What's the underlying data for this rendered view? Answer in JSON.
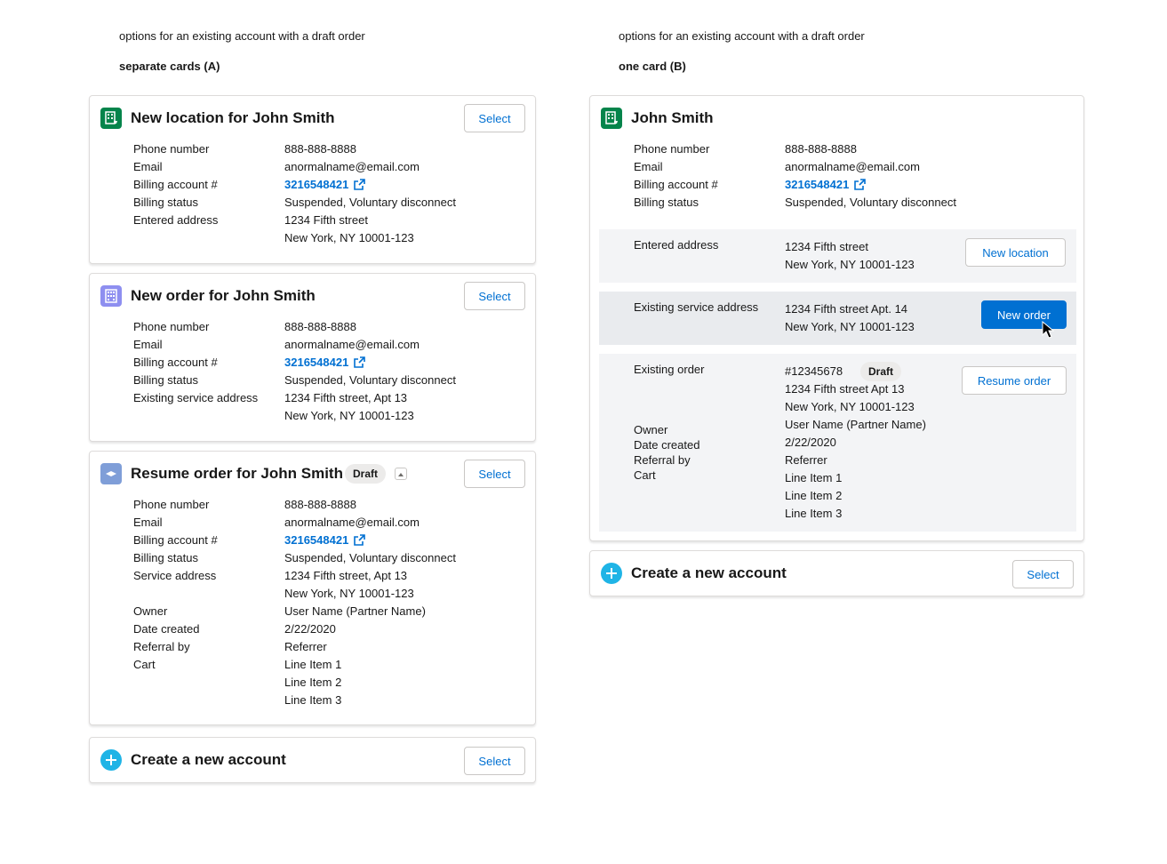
{
  "left": {
    "caption": "options for an existing account with a draft order",
    "subcaption": "separate cards (A)",
    "card1": {
      "icon": "building-cart-icon",
      "title": "New location for John Smith",
      "select": "Select",
      "rows": [
        {
          "label": "Phone number",
          "value": "888-888-8888"
        },
        {
          "label": "Email",
          "value": "anormalname@email.com"
        },
        {
          "label": "Billing account #",
          "value": "3216548421"
        },
        {
          "label": "Billing status",
          "value": "Suspended, Voluntary disconnect"
        },
        {
          "label": "Entered address",
          "value": "1234 Fifth street"
        },
        {
          "label": "",
          "value": "New York, NY 10001-123"
        }
      ]
    },
    "card2": {
      "icon": "building-grid-icon",
      "title": "New order for John Smith",
      "select": "Select",
      "rows": [
        {
          "label": "Phone number",
          "value": "888-888-8888"
        },
        {
          "label": "Email",
          "value": "anormalname@email.com"
        },
        {
          "label": "Billing account #",
          "value": "3216548421"
        },
        {
          "label": "Billing status",
          "value": "Suspended, Voluntary disconnect"
        },
        {
          "label": "Existing service address",
          "value": "1234 Fifth street, Apt 13"
        },
        {
          "label": "",
          "value": "New York, NY 10001-123"
        }
      ]
    },
    "card3": {
      "icon": "order-icon",
      "title": "Resume order for John Smith",
      "badge": "Draft",
      "select": "Select",
      "rows": [
        {
          "label": "Phone number",
          "value": "888-888-8888"
        },
        {
          "label": "Email",
          "value": "anormalname@email.com"
        },
        {
          "label": "Billing account #",
          "value": "3216548421"
        },
        {
          "label": "Billing status",
          "value": "Suspended, Voluntary disconnect"
        },
        {
          "label": "Service address",
          "value": "1234 Fifth street, Apt 13"
        },
        {
          "label": "",
          "value": "New York, NY 10001-123"
        },
        {
          "label": "Owner",
          "value": "User Name (Partner Name)"
        },
        {
          "label": "Date created",
          "value": "2/22/2020"
        },
        {
          "label": "Referral by",
          "value": "Referrer"
        },
        {
          "label": "Cart",
          "value": "Line Item 1"
        },
        {
          "label": "",
          "value": "Line Item 2"
        },
        {
          "label": "",
          "value": "Line Item 3"
        }
      ]
    },
    "card4": {
      "icon": "add-icon",
      "title": "Create a new account",
      "select": "Select"
    }
  },
  "right": {
    "caption": "options for an existing account with a draft order",
    "subcaption": "one card (B)",
    "card": {
      "icon": "building-cart-icon",
      "title": "John Smith",
      "rows": [
        {
          "label": "Phone number",
          "value": "888-888-8888"
        },
        {
          "label": "Email",
          "value": "anormalname@email.com"
        },
        {
          "label": "Billing account #",
          "value": "3216548421"
        },
        {
          "label": "Billing status",
          "value": "Suspended, Voluntary disconnect"
        }
      ],
      "entered": {
        "label": "Entered address",
        "line1": "1234 Fifth street",
        "line2": "New York, NY 10001-123",
        "button": "New location"
      },
      "existing_service": {
        "label": "Existing service address",
        "line1": "1234 Fifth street Apt. 14",
        "line2": "New York, NY 10001-123",
        "button": "New order"
      },
      "existing_order": {
        "label": "Existing order",
        "number": "#12345678",
        "badge": "Draft",
        "line1": "1234 Fifth street Apt 13",
        "line2": "New York, NY 10001-123",
        "button": "Resume order",
        "labels": [
          "Owner",
          "Date created",
          "Referral by",
          "Cart"
        ],
        "values": [
          "User Name (Partner Name)",
          "2/22/2020",
          "Referrer",
          "Line Item 1",
          "Line Item 2",
          "Line Item 3"
        ]
      }
    },
    "create": {
      "icon": "add-icon",
      "title": "Create a new account",
      "select": "Select"
    }
  },
  "colors": {
    "brand": "#0070d2",
    "icon_green": "#04844b",
    "icon_purple": "#8e8ff0",
    "icon_blue": "#7f9ed8",
    "icon_add": "#1fb4e6"
  }
}
